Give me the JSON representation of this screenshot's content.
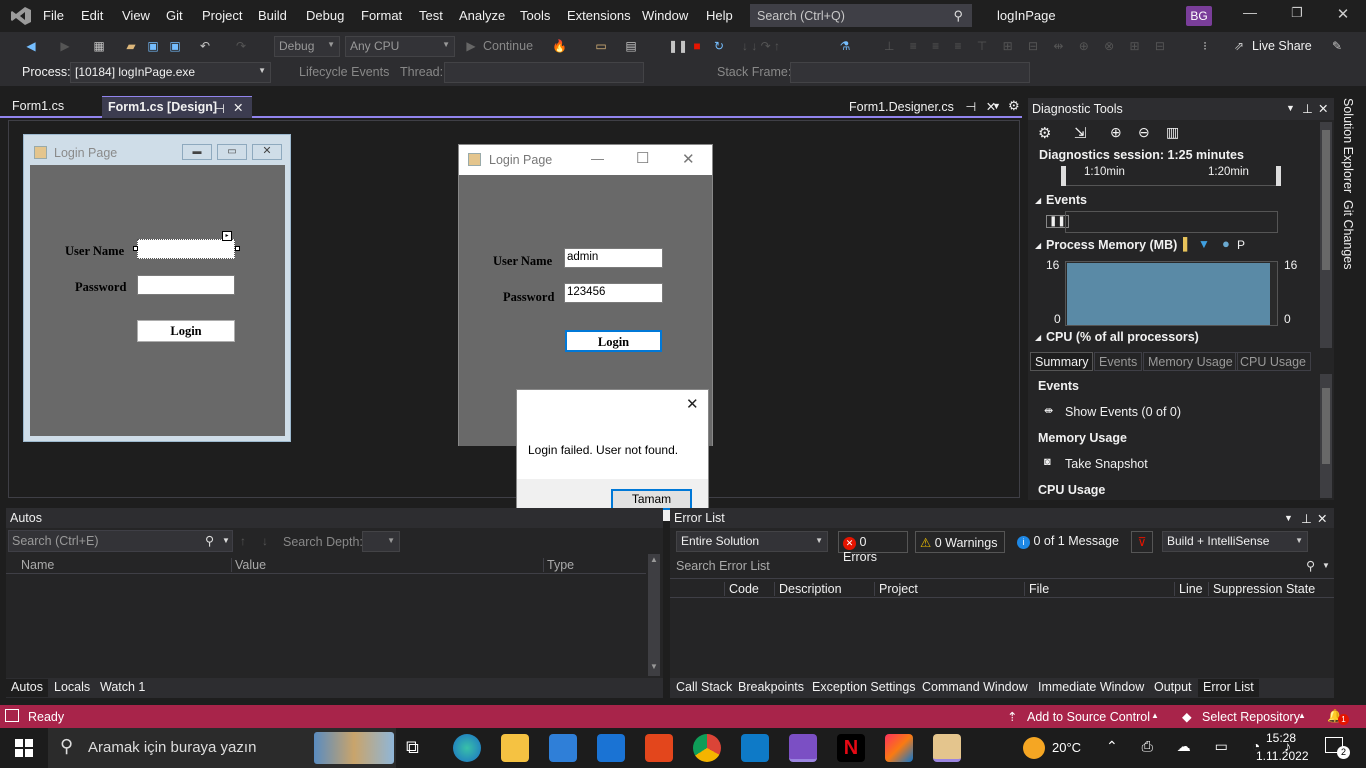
{
  "titlebar": {
    "menu": [
      "File",
      "Edit",
      "View",
      "Git",
      "Project",
      "Build",
      "Debug",
      "Format",
      "Test",
      "Analyze",
      "Tools",
      "Extensions",
      "Window",
      "Help"
    ],
    "search_placeholder": "Search (Ctrl+Q)",
    "solution_name": "logInPage",
    "user_initials": "BG"
  },
  "toolbar": {
    "config": "Debug",
    "platform": "Any CPU",
    "continue_label": "Continue",
    "live_share": "Live Share"
  },
  "toolbar2": {
    "process_label": "Process:",
    "process_value": "[10184] logInPage.exe",
    "lifecycle": "Lifecycle Events",
    "thread_label": "Thread:",
    "stack_frame_label": "Stack Frame:"
  },
  "doc_tabs": {
    "tab1": "Form1.cs",
    "tab2": "Form1.cs [Design]",
    "tab3": "Form1.Designer.cs"
  },
  "design_form": {
    "title": "Login Page",
    "username_label": "User Name",
    "password_label": "Password",
    "login_button": "Login"
  },
  "running_form": {
    "title": "Login Page",
    "username_label": "User Name",
    "password_label": "Password",
    "username_value": "admin",
    "password_value": "123456",
    "login_button": "Login"
  },
  "message_box": {
    "message": "Login failed. User not found.",
    "ok_button": "Tamam"
  },
  "diagnostics": {
    "title": "Diagnostic Tools",
    "session": "Diagnostics session: 1:25 minutes",
    "tick1": "1:10min",
    "tick2": "1:20min",
    "events_header": "Events",
    "memory_header": "Process Memory (MB)",
    "mem_top": "16",
    "mem_bottom": "0",
    "cpu_header": "CPU (% of all processors)",
    "legend_p": "P",
    "tabs": [
      "Summary",
      "Events",
      "Memory Usage",
      "CPU Usage"
    ],
    "sum_events": "Events",
    "show_events": "Show Events (0 of 0)",
    "sum_memory": "Memory Usage",
    "take_snapshot": "Take Snapshot",
    "sum_cpu": "CPU Usage",
    "side_solution": "Solution Explorer",
    "side_git": "Git Changes"
  },
  "autos": {
    "title": "Autos",
    "search_placeholder": "Search (Ctrl+E)",
    "search_depth": "Search Depth:",
    "columns": [
      "Name",
      "Value",
      "Type"
    ],
    "bottom_tabs": [
      "Autos",
      "Locals",
      "Watch 1"
    ]
  },
  "error_list": {
    "title": "Error List",
    "scope": "Entire Solution",
    "errors": "0 Errors",
    "warnings": "0 Warnings",
    "messages": "0 of 1 Message",
    "build_filter": "Build + IntelliSense",
    "search_placeholder": "Search Error List",
    "columns": [
      "Code",
      "Description",
      "Project",
      "File",
      "Line",
      "Suppression State"
    ],
    "bottom_tabs": [
      "Call Stack",
      "Breakpoints",
      "Exception Settings",
      "Command Window",
      "Immediate Window",
      "Output",
      "Error List"
    ]
  },
  "statusbar": {
    "ready": "Ready",
    "source_control": "Add to Source Control",
    "repository": "Select Repository",
    "notifications": "1"
  },
  "taskbar": {
    "search_placeholder": "Aramak için buraya yazın",
    "weather": "20°C",
    "time": "15:28",
    "date": "1.11.2022",
    "notif_count": "2"
  }
}
